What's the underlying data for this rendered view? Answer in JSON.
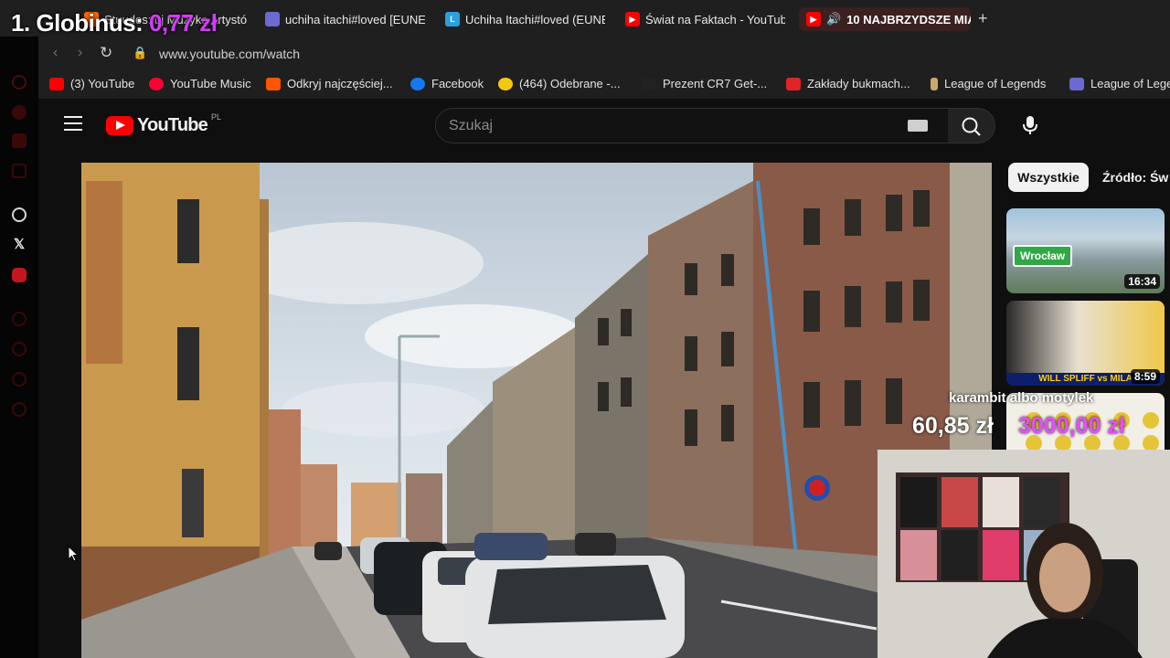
{
  "stream_overlay": {
    "rank_label": "1. Globinus:",
    "rank_amount": "0,77 zł",
    "bet_title": "karambit albo motylek",
    "bet_left": "60,85 zł",
    "bet_right": "3000,00 zł"
  },
  "browser": {
    "tabs": [
      {
        "label": "Stuudes: uj Muzykę artystó",
        "icon": "music-icon",
        "color": "#ff6a00"
      },
      {
        "label": "uchiha itachi#loved [EUNE",
        "icon": "league-icon",
        "color": "#6a6ad0"
      },
      {
        "label": "Uchiha Itachi#loved (EUNE",
        "icon": "l-icon",
        "color": "#2aa0e0"
      },
      {
        "label": "Świat na Faktach - YouTube",
        "icon": "youtube-icon",
        "color": "#ff0000"
      },
      {
        "label": "10 NAJBRZYDSZE MIA",
        "icon": "youtube-icon",
        "color": "#ff0000",
        "active": true,
        "audio": true
      }
    ],
    "new_tab_label": "+",
    "url": "www.youtube.com/watch",
    "bookmarks": [
      {
        "label": "(3) YouTube",
        "icon": "youtube-icon",
        "color": "#ff0000"
      },
      {
        "label": "YouTube Music",
        "icon": "youtube-music-icon",
        "color": "#ff0033"
      },
      {
        "label": "Odkryj najczęściej...",
        "icon": "soundcloud-icon",
        "color": "#ff5500"
      },
      {
        "label": "Facebook",
        "icon": "facebook-icon",
        "color": "#1877f2"
      },
      {
        "label": "(464) Odebrane -...",
        "icon": "mail-icon",
        "color": "#f2c811"
      },
      {
        "label": "Prezent CR7 Get-...",
        "icon": "gift-icon",
        "color": "#222222"
      },
      {
        "label": "Zakłady bukmach...",
        "icon": "betting-icon",
        "color": "#e0242a"
      },
      {
        "label": "League of Legends",
        "icon": "lol-icon",
        "color": "#c8aa6e"
      },
      {
        "label": "League of Legends",
        "icon": "league-icon",
        "color": "#6a6ad0"
      }
    ]
  },
  "youtube": {
    "logo_text": "YouTube",
    "country_code": "PL",
    "search_placeholder": "Szukaj",
    "chips": [
      "Wszystkie",
      "Źródło: Św"
    ],
    "recommended": [
      {
        "duration": "16:34",
        "tag": "Wrocław"
      },
      {
        "duration": "8:59",
        "tag": "WILL SPLIFF vs MILA"
      },
      {
        "duration": "",
        "tag": ""
      }
    ]
  },
  "colors": {
    "youtube_red": "#ff0000",
    "overlay_accent": "#d53bff",
    "background": "#0f0f0f"
  }
}
